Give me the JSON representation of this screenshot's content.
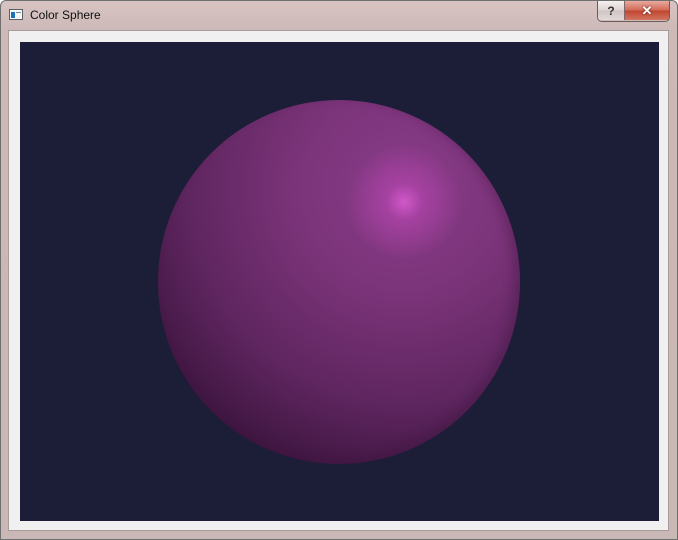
{
  "window": {
    "title": "Color Sphere",
    "help_label": "?",
    "close_label": "✕"
  },
  "icons": {
    "app": "application-window-icon",
    "help": "question-mark-icon",
    "close": "close-icon"
  },
  "viewport": {
    "background_color": "#1c1d37",
    "sphere_color": "#7a3378",
    "highlight_color": "#c850c0"
  }
}
